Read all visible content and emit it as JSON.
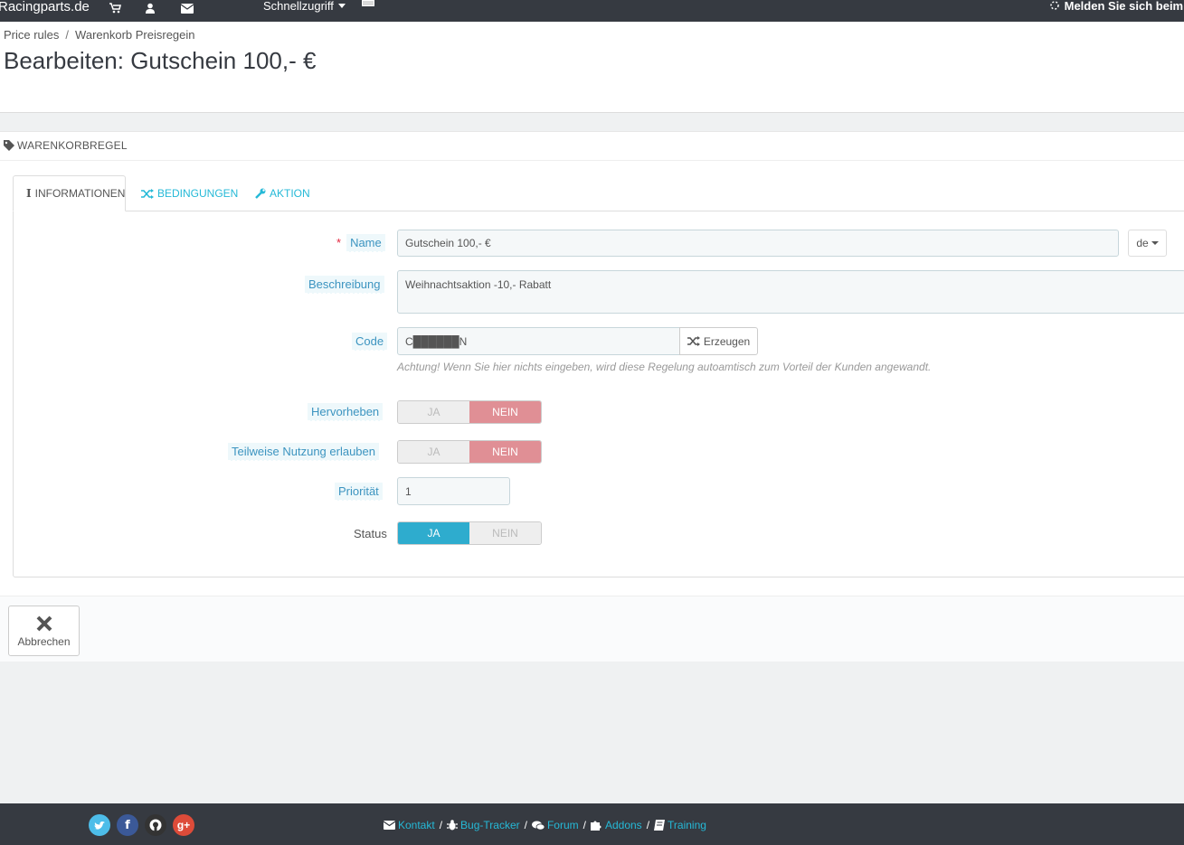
{
  "topbar": {
    "brand": "Racingparts.de",
    "quick_access": "Schnellzugriff",
    "login_text": "Melden Sie sich beim Pr"
  },
  "breadcrumb": [
    "Price rules",
    "Warenkorb Preisregein"
  ],
  "page_title": "Bearbeiten: Gutschein 100,- €",
  "panel": {
    "heading": "Warenkorbregel",
    "tabs": [
      {
        "label": "Informationen",
        "active": true
      },
      {
        "label": "Bedingungen",
        "active": false
      },
      {
        "label": "Aktion",
        "active": false
      }
    ]
  },
  "form": {
    "name_label": "Name",
    "name_value": "Gutschein 100,- €",
    "lang": "de",
    "description_label": "Beschreibung",
    "description_value": "Weihnachtsaktion -10,- Rabatt",
    "code_label": "Code",
    "code_value": "C██████N",
    "generate_label": "Erzeugen",
    "code_help": "Achtung! Wenn Sie hier nichts eingeben, wird diese Regelung autoamtisch zum Vorteil der Kunden angewandt.",
    "highlight_label": "Hervorheben",
    "partial_label": "Teilweise Nutzung erlauben",
    "priority_label": "Priorität",
    "priority_value": "1",
    "status_label": "Status",
    "yes": "JA",
    "no": "NEIN"
  },
  "cancel_label": "Abbrechen",
  "footer": {
    "links": [
      "Kontakt",
      "Bug-Tracker",
      "Forum",
      "Addons",
      "Training"
    ]
  },
  "colors": {
    "accent": "#25b9d7",
    "dark": "#363a41",
    "no_active": "#e08f95",
    "yes_active": "#2eacce"
  }
}
